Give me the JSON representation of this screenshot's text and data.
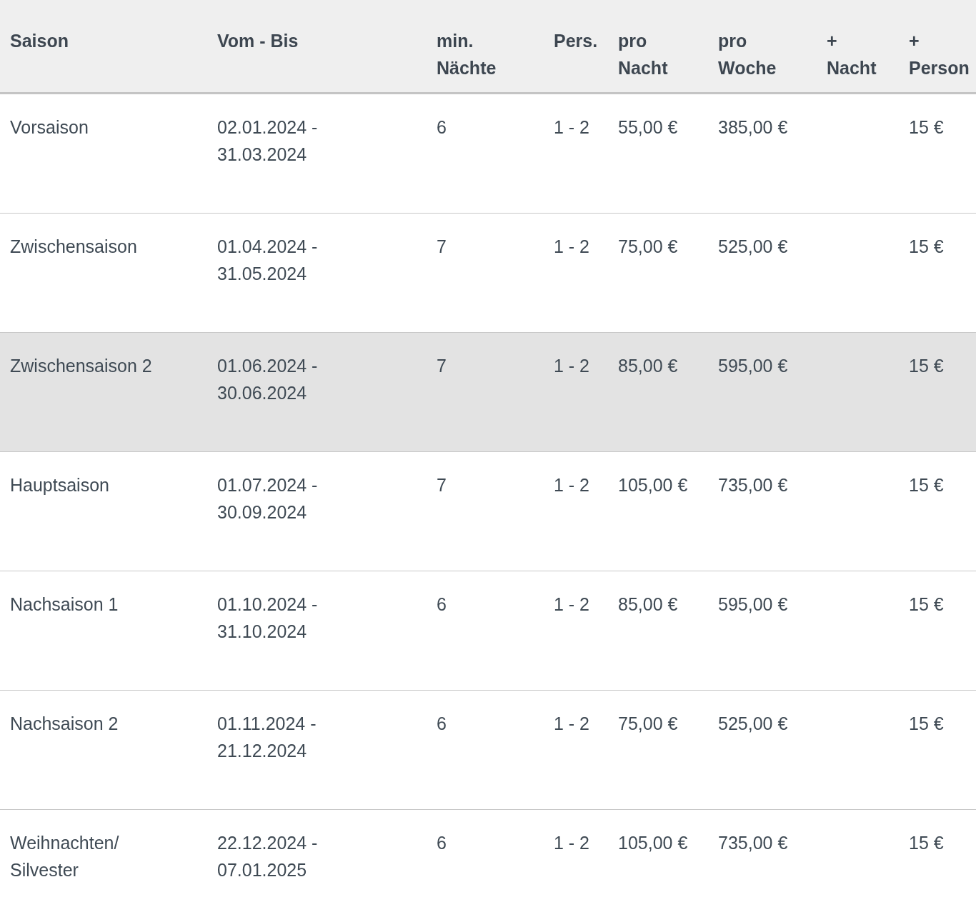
{
  "table": {
    "columns": [
      "Saison",
      "Vom - Bis",
      "min.\nNächte",
      "Pers.",
      "pro\nNacht",
      "pro\nWoche",
      "+\nNacht",
      "+\nPerson"
    ],
    "rows": [
      {
        "selected": false,
        "cells": [
          "Vorsaison",
          "02.01.2024 -\n31.03.2024",
          "6",
          "1 - 2",
          "55,00 €",
          "385,00 €",
          "",
          "15 €"
        ]
      },
      {
        "selected": false,
        "cells": [
          "Zwischensaison",
          "01.04.2024 -\n31.05.2024",
          "7",
          "1 - 2",
          "75,00 €",
          "525,00 €",
          "",
          "15 €"
        ]
      },
      {
        "selected": true,
        "cells": [
          "Zwischensaison 2",
          "01.06.2024 -\n30.06.2024",
          "7",
          "1 - 2",
          "85,00 €",
          "595,00 €",
          "",
          "15 €"
        ]
      },
      {
        "selected": false,
        "cells": [
          "Hauptsaison",
          "01.07.2024 -\n30.09.2024",
          "7",
          "1 - 2",
          "105,00 €",
          "735,00 €",
          "",
          "15 €"
        ]
      },
      {
        "selected": false,
        "cells": [
          "Nachsaison 1",
          "01.10.2024 -\n31.10.2024",
          "6",
          "1 - 2",
          "85,00 €",
          "595,00 €",
          "",
          "15 €"
        ]
      },
      {
        "selected": false,
        "cells": [
          "Nachsaison 2",
          "01.11.2024 -\n21.12.2024",
          "6",
          "1 - 2",
          "75,00 €",
          "525,00 €",
          "",
          "15 €"
        ]
      },
      {
        "selected": false,
        "cells": [
          "Weihnachten/\nSilvester",
          "22.12.2024 -\n07.01.2025",
          "6",
          "1 - 2",
          "105,00 €",
          "735,00 €",
          "",
          "15 €"
        ]
      }
    ]
  }
}
